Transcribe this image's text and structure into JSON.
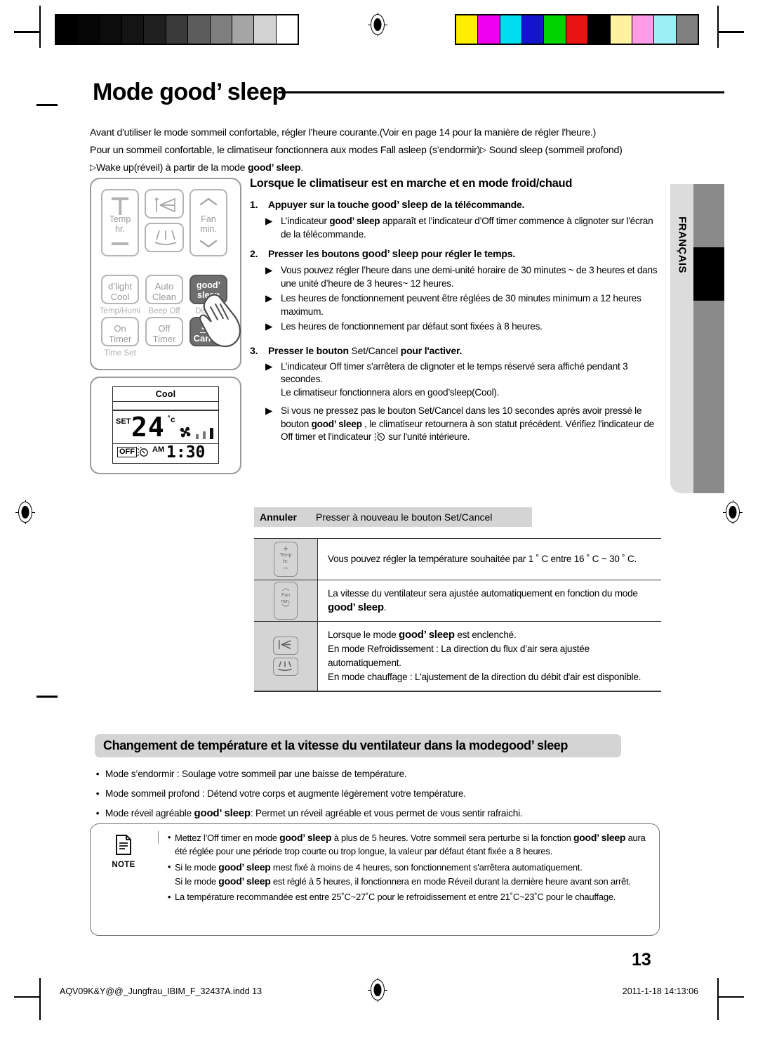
{
  "document": {
    "title_prefix": "Mode",
    "title_brand": "good’ sleep",
    "page_number": "13",
    "side_tab_language": "FRANÇAIS"
  },
  "intro": {
    "line1": "Avant d'utiliser le mode sommeil confortable, régler l'heure courante.(Voir en page 14 pour la manière de régler l'heure.)",
    "line2_a": "Pour un sommeil confortable, le climatiseur fonctionnera aux modes Fall asleep (s’endormir)",
    "line2_b": "Sound sleep (sommeil profond)",
    "line3_a": "Wake up(réveil) à partir de la mode",
    "line3_b": "good’ sleep",
    "line3_c": "."
  },
  "remote": {
    "buttons": {
      "temp_plus": "+",
      "temp_label_1": "Temp",
      "temp_label_2": "hr.",
      "temp_minus": "−",
      "swing_vertical": "swing-vertical-icon",
      "swing_horizontal": "swing-horizontal-icon",
      "fan_up": "︿",
      "fan_label_1": "Fan",
      "fan_label_2": "min.",
      "fan_down": "﹀",
      "dlight_1": "d’light",
      "dlight_2": "Cool",
      "dlight_sub": "Temp/Humi",
      "autoclean_1": "Auto",
      "autoclean_2": "Clean",
      "autoclean_sub": "Beep Off",
      "goodsleep_1": "good’",
      "goodsleep_2": "sleep",
      "goodsleep_sub": "Display",
      "ontimer_1": "On",
      "ontimer_2": "Timer",
      "offtimer_1": "Off",
      "offtimer_2": "Timer",
      "timeset_sub": "Time Set",
      "setcancel_1": "Set",
      "setcancel_2": "Cancel"
    }
  },
  "lcd": {
    "mode": "Cool",
    "set_label": "SET",
    "temperature": "24",
    "degree_unit": "˚c",
    "off_badge": "OFF",
    "moon_icon": "good-sleep-icon",
    "meridiem": "AM",
    "time": "1:30",
    "fan_icon": "fan-icon"
  },
  "main": {
    "section_heading": "Lorsque le climatiseur est en marche et en mode froid/chaud",
    "steps": [
      {
        "num": "1.",
        "text_a": "Appuyer sur la touche ",
        "brand": "good’ sleep",
        "text_b": " de la télécommande.",
        "bullets": [
          {
            "a": "L’indicateur ",
            "brand": "good’ sleep",
            "b": " apparaît et  l’indicateur d’Off timer commence à clignoter sur l'écran de la télécommande."
          }
        ]
      },
      {
        "num": "2.",
        "text_a": "Presser les boutons ",
        "brand": "good’ sleep",
        "text_b": " pour régler le temps.",
        "bullets": [
          {
            "a": "Vous pouvez régler l’heure dans une demi-unité horaire de 30 minutes ~ de 3 heures et dans une unité d’heure de 3 heures~ 12 heures."
          },
          {
            "a": "Les heures de fonctionnement peuvent être réglées de 30 minutes minimum a 12 heures maximum."
          },
          {
            "a": "Les heures de fonctionnement par défaut sont fixées à 8 heures."
          }
        ]
      },
      {
        "num": "3.",
        "text_a": "Presser le bouton ",
        "brand": "Set/Cancel",
        "text_b": " pour l'activer.",
        "bullets": [
          {
            "a": "L’indicateur Off timer s'arrêtera de clignoter et le temps réservé sera affiché pendant 3 secondes.\nLe climatiseur fonctionnera alors en good’sleep(Cool)."
          },
          {
            "a": "Si vous ne pressez pas le bouton Set/Cancel dans les 10 secondes après avoir pressé le bouton ",
            "brand": "good’ sleep",
            "b": " , le climatiseur retournera  à son statut précédent.  Vérifiez l'indicateur de Off timer et l'indicateur ",
            "c": " sur l'unité intérieure."
          }
        ]
      }
    ],
    "cancel_row": {
      "label": "Annuler",
      "value": "Presser à nouveau le bouton Set/Cancel"
    },
    "feature_table": [
      {
        "icon": "temp-button-icon",
        "icon_labels": [
          "+",
          "Temp",
          "hr.",
          "−"
        ],
        "text": "Vous pouvez régler la température souhaitée par 1 ˚ C entre 16 ˚ C ~ 30 ˚ C."
      },
      {
        "icon": "fan-button-icon",
        "icon_labels": [
          "︿",
          "Fan",
          "min.",
          "﹀"
        ],
        "text_a": "La vitesse du ventilateur sera ajustée automatiquement en fonction du mode ",
        "brand": "good’ sleep",
        "text_b": "."
      },
      {
        "icon": "swing-buttons-icon",
        "lines": [
          {
            "a": "Lorsque le mode ",
            "brand": "good’ sleep",
            "b": " est enclenché."
          },
          {
            "a": "En mode Refroidissement : La direction du flux d’air sera ajustée automatiquement."
          },
          {
            "a": "En mode chauffage : L'ajustement de la direction du débit d'air est disponible."
          }
        ]
      }
    ]
  },
  "bottom": {
    "band_a": "Changement de température et la vitesse du ventilateur dans la mode ",
    "band_brand": "good’ sleep",
    "bullets": [
      {
        "a": "Mode s’endormir : Soulage votre sommeil par une baisse de température."
      },
      {
        "a": "Mode sommeil profond : Détend votre corps et augmente légèrement votre température."
      },
      {
        "a": "Mode réveil agréable ",
        "brand": "good’ sleep",
        "b": ": Permet un réveil agréable et vous permet de vous sentir rafraichi."
      }
    ]
  },
  "note": {
    "label": "NOTE",
    "items": [
      {
        "a": " Mettez l’Off timer en mode ",
        "brand": "good’ sleep",
        "b": " à plus de 5 heures. Votre sommeil sera perturbe si la fonction ",
        "brand2": "good’ sleep",
        "c": " aura été réglée pour une période trop courte ou trop longue, la valeur par défaut étant fixée a 8 heures."
      },
      {
        "a": "Si le mode ",
        "brand": "good’ sleep",
        "b": " mest fixé à moins de 4 heures, son fonctionnement s'arrêtera automatiquement.",
        "a2": "Si le mode ",
        "brand2": "good’ sleep",
        "b2": " est réglé à 5 heures, il fonctionnera en mode Réveil durant la dernière heure avant son arrêt."
      },
      {
        "a": "La température recommandée est entre 25˚C~27˚C pour le refroidissement et entre 21˚C~23˚C pour le chauffage."
      }
    ]
  },
  "footer": {
    "file": "AQV09K&Y@@_Jungfrau_IBIM_F_32437A.indd   13",
    "timestamp": "2011-1-18   14:13:06"
  },
  "calibration": {
    "grayscale": [
      "#000000",
      "#050505",
      "#0c0c0c",
      "#141414",
      "#1f1f1f",
      "#3a3a3a",
      "#5c5c5c",
      "#7e7e7e",
      "#a5a5a5",
      "#d2d2d2",
      "#ffffff"
    ],
    "colors": [
      "#ffee00",
      "#ee00ee",
      "#00ddee",
      "#1414cc",
      "#00d400",
      "#e81414",
      "#000000",
      "#fff29e",
      "#ff9ce8",
      "#9cf0f5",
      "#808080"
    ]
  }
}
